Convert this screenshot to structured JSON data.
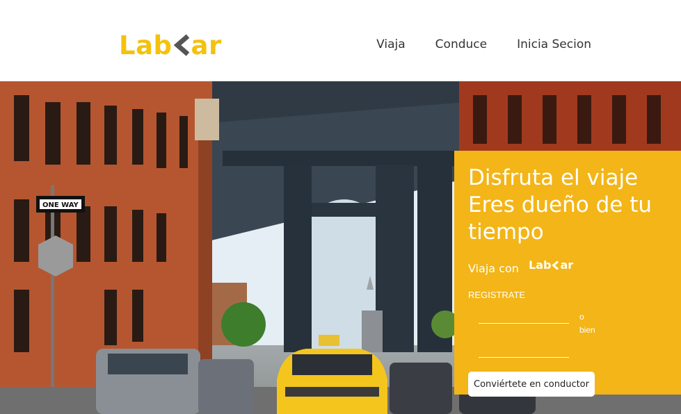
{
  "brand": {
    "logo_left": "Lab",
    "logo_right": "ar",
    "color": "#f4c20d"
  },
  "nav": {
    "items": [
      "Viaja",
      "Conduce",
      "Inicia Secion"
    ]
  },
  "hero": {
    "headline_line1": "Disfruta el viaje",
    "headline_line2": "Eres dueño de tu",
    "headline_line3": "tiempo",
    "viaja_con": "Viaja con",
    "mini_logo_left": "Lab",
    "mini_logo_right": "ar",
    "registrate": "REGISTRATE",
    "field1_value": "",
    "field2_value": "",
    "o": "o",
    "bien": "bien",
    "cta": "Conviértete en conductor",
    "panel_color": "#f3b517"
  },
  "image": {
    "street_signs": [
      "ONE WAY"
    ]
  }
}
